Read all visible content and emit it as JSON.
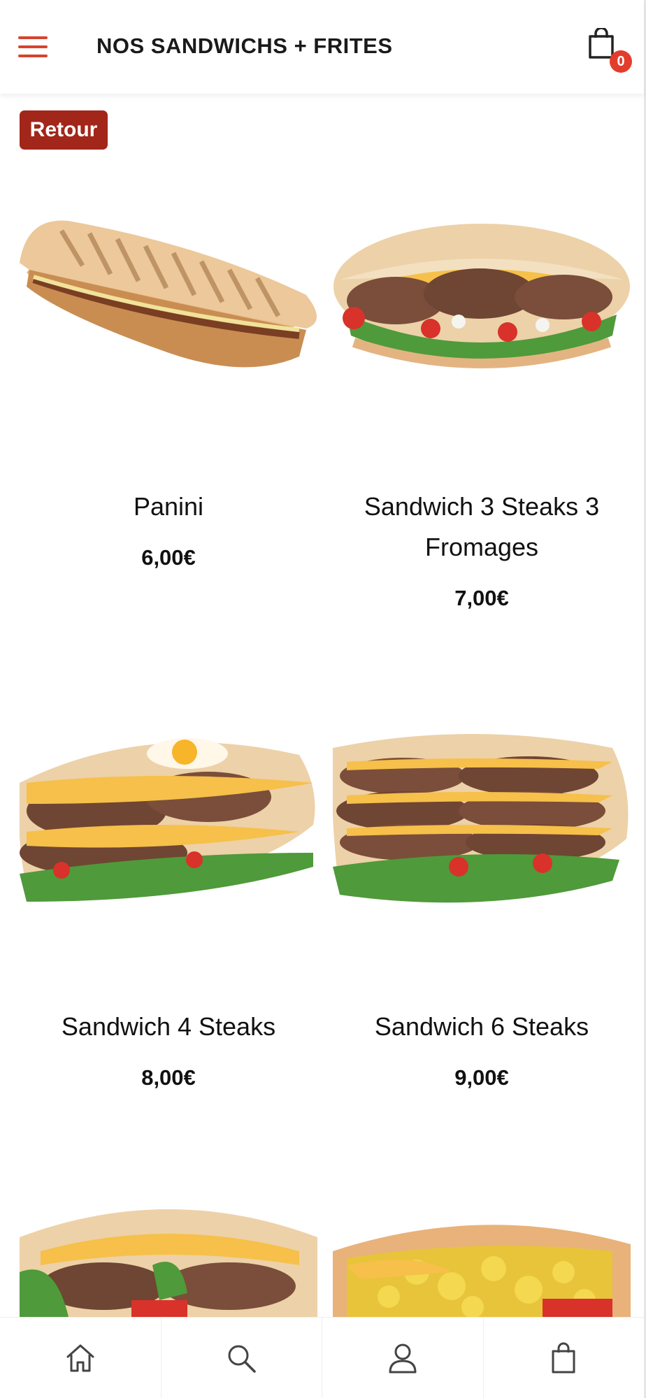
{
  "header": {
    "title": "NOS SANDWICHS + FRITES",
    "cart_count": "0"
  },
  "back_label": "Retour",
  "products": [
    {
      "name": "Panini",
      "price": "6,00€"
    },
    {
      "name": "Sandwich 3 Steaks 3 Fromages",
      "price": "7,00€"
    },
    {
      "name": "Sandwich 4 Steaks",
      "price": "8,00€"
    },
    {
      "name": "Sandwich 6 Steaks",
      "price": "9,00€"
    }
  ],
  "bottom_nav": {
    "items": [
      {
        "icon": "home-icon"
      },
      {
        "icon": "search-icon"
      },
      {
        "icon": "user-icon"
      },
      {
        "icon": "shopping-bag-icon"
      }
    ]
  },
  "colors": {
    "accent": "#d8432e",
    "back_button": "#a2261a",
    "badge": "#e43c2c"
  }
}
